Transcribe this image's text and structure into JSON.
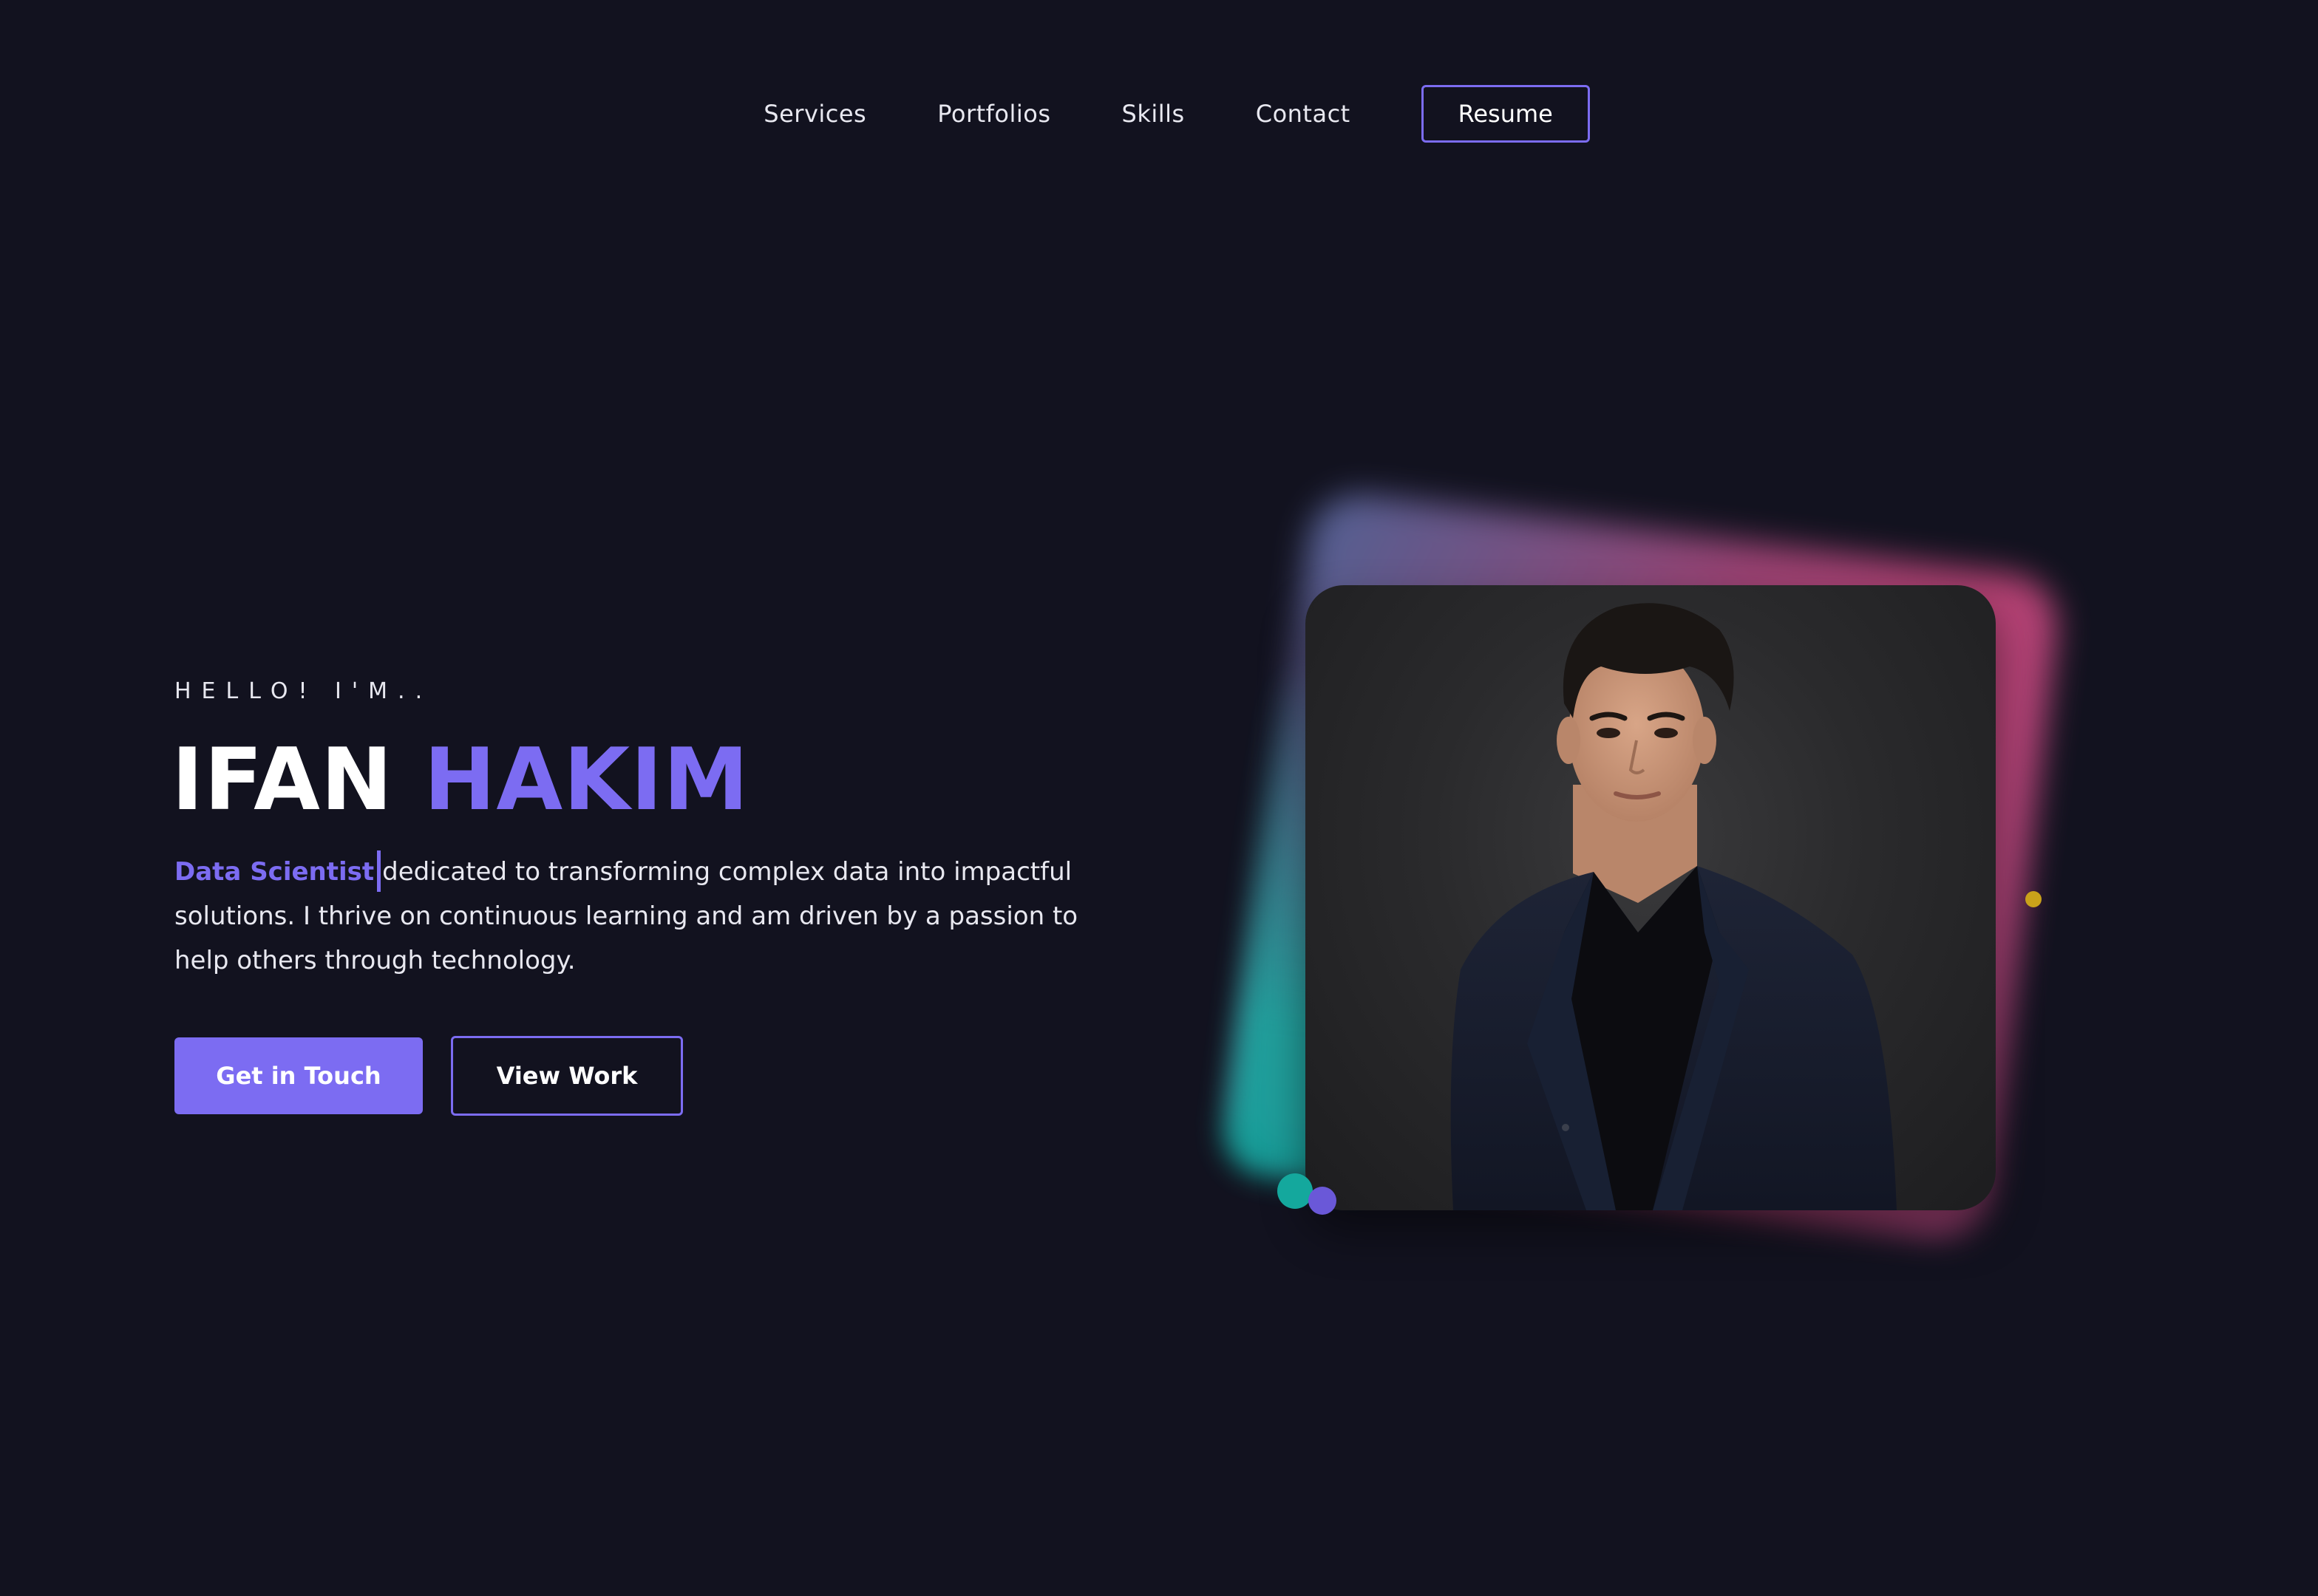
{
  "nav": {
    "items": [
      {
        "label": "Services"
      },
      {
        "label": "Portfolios"
      },
      {
        "label": "Skills"
      },
      {
        "label": "Contact"
      }
    ],
    "resume_label": "Resume"
  },
  "hero": {
    "greeting": "HELLO! I'M..",
    "first_name": "IFAN",
    "last_name": "HAKIM",
    "role": "Data Scientist",
    "bio": "dedicated to transforming complex data into impactful solutions. I thrive on continuous learning and am driven by a passion to help others through technology.",
    "primary_button": "Get in Touch",
    "secondary_button": "View Work"
  },
  "colors": {
    "background": "#12121f",
    "accent": "#7c6cf2",
    "teal": "#14a89d",
    "pink": "#d24a82",
    "yellow": "#c9a21a"
  },
  "icons": {
    "portrait": "portrait-photo"
  }
}
